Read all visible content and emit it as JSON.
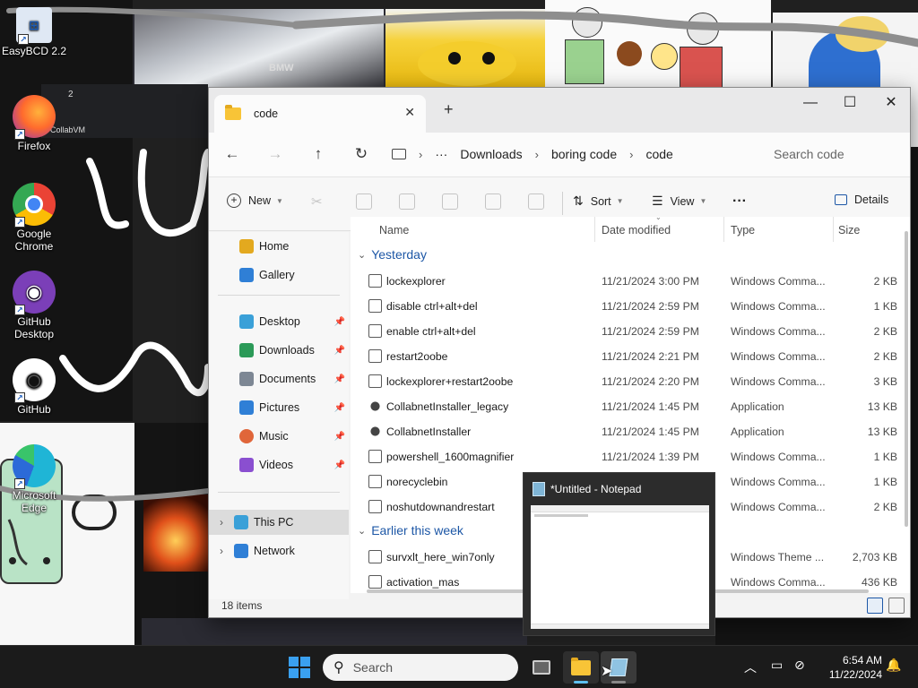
{
  "desktop": {
    "icons": [
      {
        "label": "EasyBCD 2.2",
        "icon": "easybcd-icon"
      },
      {
        "label": "Firefox",
        "icon": "firefox-icon"
      },
      {
        "label": "Google Chrome",
        "icon": "chrome-icon"
      },
      {
        "label": "GitHub Desktop",
        "icon": "github-desktop-icon"
      },
      {
        "label": "GitHub",
        "icon": "github-icon"
      },
      {
        "label": "Microsoft Edge",
        "icon": "edge-icon"
      }
    ],
    "wallpaper_text": {
      "collabvm": "CollabVM",
      "tab_count": "2",
      "car_brand": "BMW"
    }
  },
  "explorer": {
    "tab_title": "code",
    "new_tab": "+",
    "window_controls": {
      "minimize": "—",
      "maximize": "☐",
      "close": "✕"
    },
    "breadcrumb": [
      "Downloads",
      "boring code",
      "code"
    ],
    "breadcrumb_more": "···",
    "search_placeholder": "Search code",
    "toolbar": {
      "new": "New",
      "sort": "Sort",
      "view": "View",
      "more": "···",
      "details": "Details"
    },
    "nav_pane": {
      "top": [
        {
          "label": "Home",
          "icon": "home-icon",
          "color": "#e3a91f"
        },
        {
          "label": "Gallery",
          "icon": "gallery-icon",
          "color": "#2f7fd6"
        }
      ],
      "pinned": [
        {
          "label": "Desktop",
          "icon": "desktop-icon",
          "color": "#3aa0d8"
        },
        {
          "label": "Downloads",
          "icon": "download-icon",
          "color": "#2b9a58"
        },
        {
          "label": "Documents",
          "icon": "documents-icon",
          "color": "#7d8794"
        },
        {
          "label": "Pictures",
          "icon": "pictures-icon",
          "color": "#2f7fd6"
        },
        {
          "label": "Music",
          "icon": "music-icon",
          "color": "#e0663a"
        },
        {
          "label": "Videos",
          "icon": "videos-icon",
          "color": "#8a4fd0"
        }
      ],
      "bottom": [
        {
          "label": "This PC",
          "icon": "pc-icon",
          "color": "#3aa0d8",
          "selected": true
        },
        {
          "label": "Network",
          "icon": "network-icon",
          "color": "#2f7fd6"
        }
      ]
    },
    "columns": {
      "name": "Name",
      "date": "Date modified",
      "type": "Type",
      "size": "Size"
    },
    "groups": [
      {
        "label": "Yesterday",
        "files": [
          {
            "name": "lockexplorer",
            "date": "11/21/2024 3:00 PM",
            "type": "Windows Comma...",
            "size": "2 KB",
            "kind": "cmd"
          },
          {
            "name": "disable ctrl+alt+del",
            "date": "11/21/2024 2:59 PM",
            "type": "Windows Comma...",
            "size": "1 KB",
            "kind": "cmd"
          },
          {
            "name": "enable ctrl+alt+del",
            "date": "11/21/2024 2:59 PM",
            "type": "Windows Comma...",
            "size": "2 KB",
            "kind": "cmd"
          },
          {
            "name": "restart2oobe",
            "date": "11/21/2024 2:21 PM",
            "type": "Windows Comma...",
            "size": "2 KB",
            "kind": "cmd"
          },
          {
            "name": "lockexplorer+restart2oobe",
            "date": "11/21/2024 2:20 PM",
            "type": "Windows Comma...",
            "size": "3 KB",
            "kind": "cmd"
          },
          {
            "name": "CollabnetInstaller_legacy",
            "date": "11/21/2024 1:45 PM",
            "type": "Application",
            "size": "13 KB",
            "kind": "app"
          },
          {
            "name": "CollabnetInstaller",
            "date": "11/21/2024 1:45 PM",
            "type": "Application",
            "size": "13 KB",
            "kind": "app"
          },
          {
            "name": "powershell_1600magnifier",
            "date": "11/21/2024 1:39 PM",
            "type": "Windows Comma...",
            "size": "1 KB",
            "kind": "cmd"
          },
          {
            "name": "norecyclebin",
            "date": "",
            "type": "Windows Comma...",
            "size": "1 KB",
            "kind": "cmd"
          },
          {
            "name": "noshutdownandrestart",
            "date": "",
            "type": "Windows Comma...",
            "size": "2 KB",
            "kind": "cmd"
          }
        ]
      },
      {
        "label": "Earlier this week",
        "files": [
          {
            "name": "survxlt_here_win7only",
            "date": "",
            "type": "Windows Theme ...",
            "size": "2,703 KB",
            "kind": "cmd"
          },
          {
            "name": "activation_mas",
            "date": "",
            "type": "Windows Comma...",
            "size": "436 KB",
            "kind": "cmd"
          }
        ]
      }
    ],
    "status": {
      "item_count": "18 items"
    }
  },
  "notepad_preview": {
    "title": "*Untitled - Notepad"
  },
  "taskbar": {
    "search_placeholder": "Search",
    "clock_time": "6:54 AM",
    "clock_date": "11/22/2024"
  }
}
